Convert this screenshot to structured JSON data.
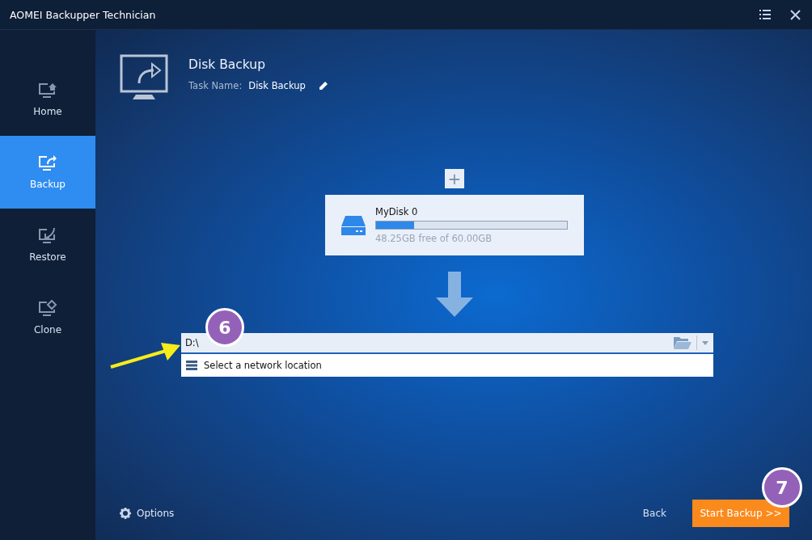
{
  "window": {
    "title": "AOMEI Backupper Technician"
  },
  "sidebar": {
    "items": [
      {
        "label": "Home",
        "kind": "home",
        "selected": false
      },
      {
        "label": "Backup",
        "kind": "backup",
        "selected": true
      },
      {
        "label": "Restore",
        "kind": "restore",
        "selected": false
      },
      {
        "label": "Clone",
        "kind": "clone",
        "selected": false
      }
    ]
  },
  "header": {
    "title": "Disk Backup",
    "task_name_label": "Task Name:",
    "task_name": "Disk Backup"
  },
  "add_button": "+",
  "source_disk": {
    "name": "MyDisk 0",
    "level": 0.2,
    "free_text": "48.25GB free of 60.00GB"
  },
  "destination": {
    "value": "D:\\",
    "dropdown_option": "Select a network location"
  },
  "footer": {
    "options": "Options",
    "back": "Back",
    "start": "Start Backup >>"
  },
  "annotations": [
    {
      "label": "6",
      "kind": "step-with-arrow"
    },
    {
      "label": "7",
      "kind": "step"
    }
  ]
}
